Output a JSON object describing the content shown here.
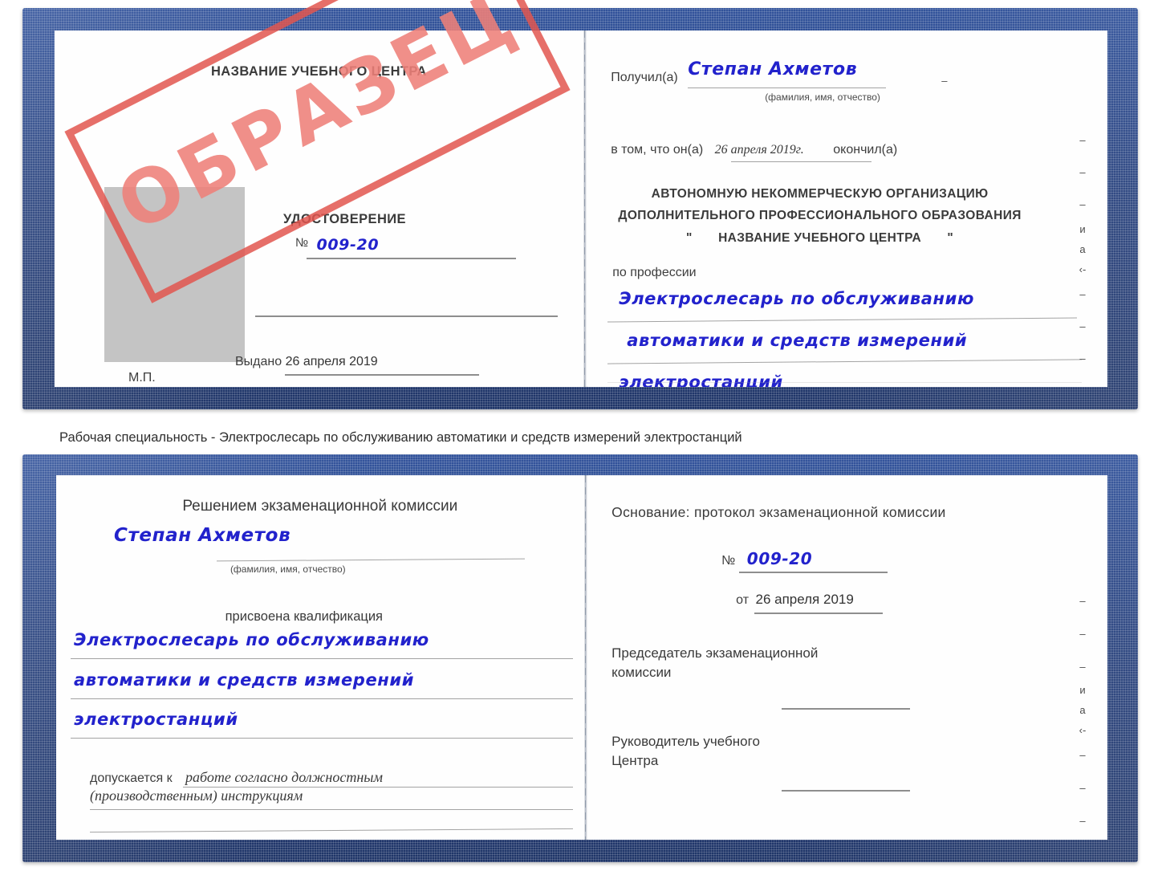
{
  "colors": {
    "cover_blue": "#27417d",
    "handwriting_blue": "#2222cc",
    "stamp_red": "#e2564f",
    "stamp_text_red": "#ef8079",
    "photo_gray": "#c4c4c4",
    "rule_gray": "#8e8e8e",
    "page_white": "#fefefe"
  },
  "stamp": {
    "text": "ОБРАЗЕЦ"
  },
  "caption": {
    "text": "Рабочая специальность - Электрослесарь по обслуживанию автоматики и средств измерений электростанций"
  },
  "certificate": {
    "left_page": {
      "center_name": "НАЗВАНИЕ УЧЕБНОГО ЦЕНТРА",
      "doc_type": "УДОСТОВЕРЕНИЕ",
      "number_symbol": "№",
      "number_value": "009-20",
      "issued_label": "Выдано",
      "issued_value": "26 апреля 2019",
      "seal_label": "М.П.",
      "photo_alt": "photo-placeholder"
    },
    "right_page": {
      "received_label": "Получил(а)",
      "received_value": "Степан Ахметов",
      "fio_hint": "(фамилия, имя, отчество)",
      "in_that_label": "в том, что он(а)",
      "in_that_value": "26 апреля 2019г.",
      "finished_label": "окончил(а)",
      "org_line1": "АВТОНОМНУЮ НЕКОММЕРЧЕСКУЮ ОРГАНИЗАЦИЮ",
      "org_line2": "ДОПОЛНИТЕЛЬНОГО ПРОФЕССИОНАЛЬНОГО ОБРАЗОВАНИЯ",
      "org_quote_open": "\"",
      "org_name": "НАЗВАНИЕ УЧЕБНОГО ЦЕНТРА",
      "org_quote_close": "\"",
      "profession_label": "по профессии",
      "profession_line1": "Электрослесарь по обслуживанию",
      "profession_line2": "автоматики и средств измерений",
      "profession_line3": "электростанций",
      "margin_fragments": [
        "–",
        "–",
        "–",
        "и",
        "а",
        "‹-",
        "–",
        "–",
        "–"
      ]
    }
  },
  "protocol": {
    "left_page": {
      "heading": "Решением экзаменационной комиссии",
      "name_value": "Степан Ахметов",
      "fio_hint": "(фамилия, имя, отчество)",
      "qualification_label": "присвоена квалификация",
      "qualification_line1": "Электрослесарь по обслуживанию",
      "qualification_line2": "автоматики и средств измерений",
      "qualification_line3": "электростанций",
      "admitted_label": "допускается к",
      "admitted_value_line1": "работе согласно должностным",
      "admitted_value_line2": "(производственным) инструкциям"
    },
    "right_page": {
      "basis_label": "Основание: протокол экзаменационной комиссии",
      "number_symbol": "№",
      "number_value": "009-20",
      "date_label": "от",
      "date_value": "26 апреля 2019",
      "chairman_line1": "Председатель экзаменационной",
      "chairman_line2": "комиссии",
      "head_line1": "Руководитель учебного",
      "head_line2": "Центра",
      "margin_fragments": [
        "–",
        "–",
        "–",
        "и",
        "а",
        "‹-",
        "–",
        "–",
        "–"
      ]
    }
  }
}
